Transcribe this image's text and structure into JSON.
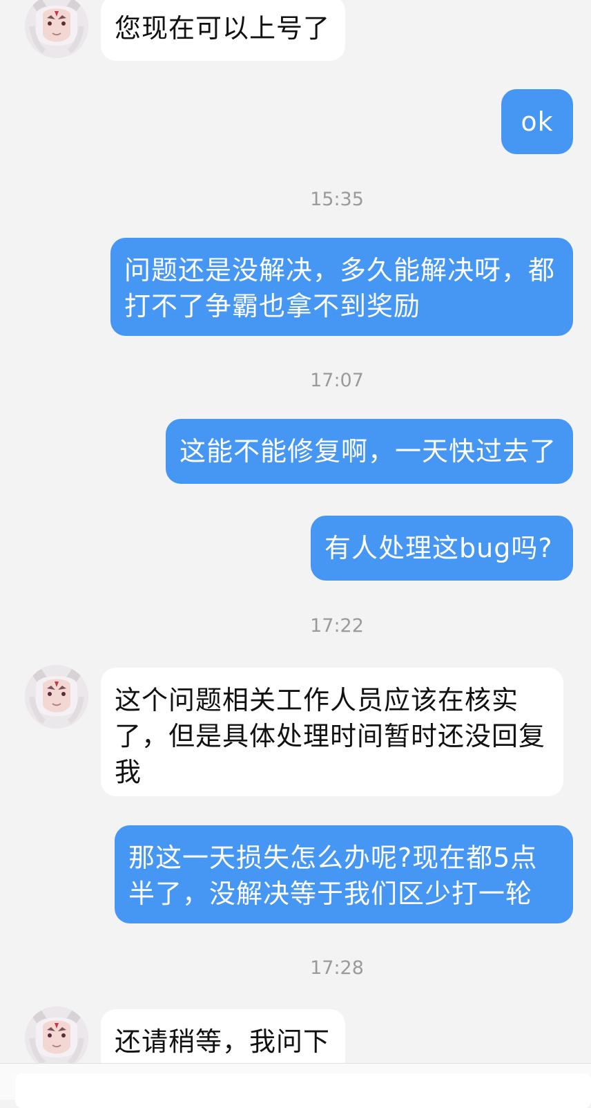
{
  "messages": [
    {
      "sender": "agent",
      "text": "您现在可以上号了"
    },
    {
      "sender": "user",
      "text": "ok"
    },
    {
      "time": "15:35"
    },
    {
      "sender": "user",
      "text": "问题还是没解决，多久能解决呀，都打不了争霸也拿不到奖励"
    },
    {
      "time": "17:07"
    },
    {
      "sender": "user",
      "text": "这能不能修复啊，一天快过去了"
    },
    {
      "sender": "user",
      "text": "有人处理这bug吗?"
    },
    {
      "time": "17:22"
    },
    {
      "sender": "agent",
      "text": "这个问题相关工作人员应该在核实了，但是具体处理时间暂时还没回复我"
    },
    {
      "sender": "user",
      "text": "那这一天损失怎么办呢?现在都5点半了，没解决等于我们区少打一轮"
    },
    {
      "time": "17:28"
    },
    {
      "sender": "agent",
      "text": "还请稍等，我问下"
    }
  ],
  "colors": {
    "user_bubble": "#4696f3",
    "agent_bubble": "#ffffff",
    "background": "#f3f3f3"
  },
  "icons": {
    "avatar": "agent-avatar-icon"
  }
}
